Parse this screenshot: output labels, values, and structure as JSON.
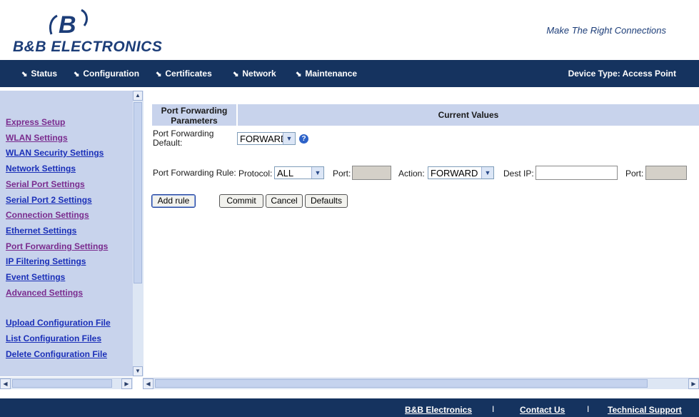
{
  "brand": {
    "logo_letter": "B",
    "logo_text": "B&B ELECTRONICS",
    "slogan": "Make The Right Connections"
  },
  "nav": {
    "items": [
      {
        "label": "Status"
      },
      {
        "label": "Configuration"
      },
      {
        "label": "Certificates"
      },
      {
        "label": "Network"
      },
      {
        "label": "Maintenance"
      }
    ],
    "device_type": "Device Type: Access Point"
  },
  "sidebar": {
    "links": [
      {
        "label": "Express Setup"
      },
      {
        "label": "WLAN Settings"
      },
      {
        "label": "WLAN Security Settings"
      },
      {
        "label": "Network Settings"
      },
      {
        "label": "Serial Port Settings"
      },
      {
        "label": "Serial Port 2 Settings"
      },
      {
        "label": "Connection Settings"
      },
      {
        "label": "Ethernet Settings"
      },
      {
        "label": "Port Forwarding Settings"
      },
      {
        "label": "IP Filtering Settings"
      },
      {
        "label": "Event Settings"
      },
      {
        "label": "Advanced Settings"
      },
      {
        "label": "Upload Configuration File"
      },
      {
        "label": "List Configuration Files"
      },
      {
        "label": "Delete Configuration File"
      }
    ]
  },
  "table": {
    "header_params": "Port Forwarding Parameters",
    "header_values": "Current Values"
  },
  "form": {
    "default_label": "Port Forwarding Default:",
    "default_value": "FORWARD",
    "rule_label": "Port Forwarding Rule:",
    "protocol_label": "Protocol:",
    "protocol_value": "ALL",
    "port_label": "Port:",
    "action_label": "Action:",
    "action_value": "FORWARD",
    "dest_ip_label": "Dest IP:",
    "dest_port_label": "Port:",
    "help_symbol": "?"
  },
  "buttons": {
    "add_rule": "Add rule",
    "commit": "Commit",
    "cancel": "Cancel",
    "defaults": "Defaults"
  },
  "footer": {
    "links": [
      {
        "label": "B&B Electronics"
      },
      {
        "label": "Contact Us"
      },
      {
        "label": "Technical Support"
      }
    ],
    "separator": "I"
  },
  "colors": {
    "nav_bg": "#15335f",
    "sidebar_bg": "#c8d3ec",
    "link_blue": "#1a2fb8",
    "link_purple": "#7a2b8e",
    "brand_blue": "#1c3d78"
  }
}
